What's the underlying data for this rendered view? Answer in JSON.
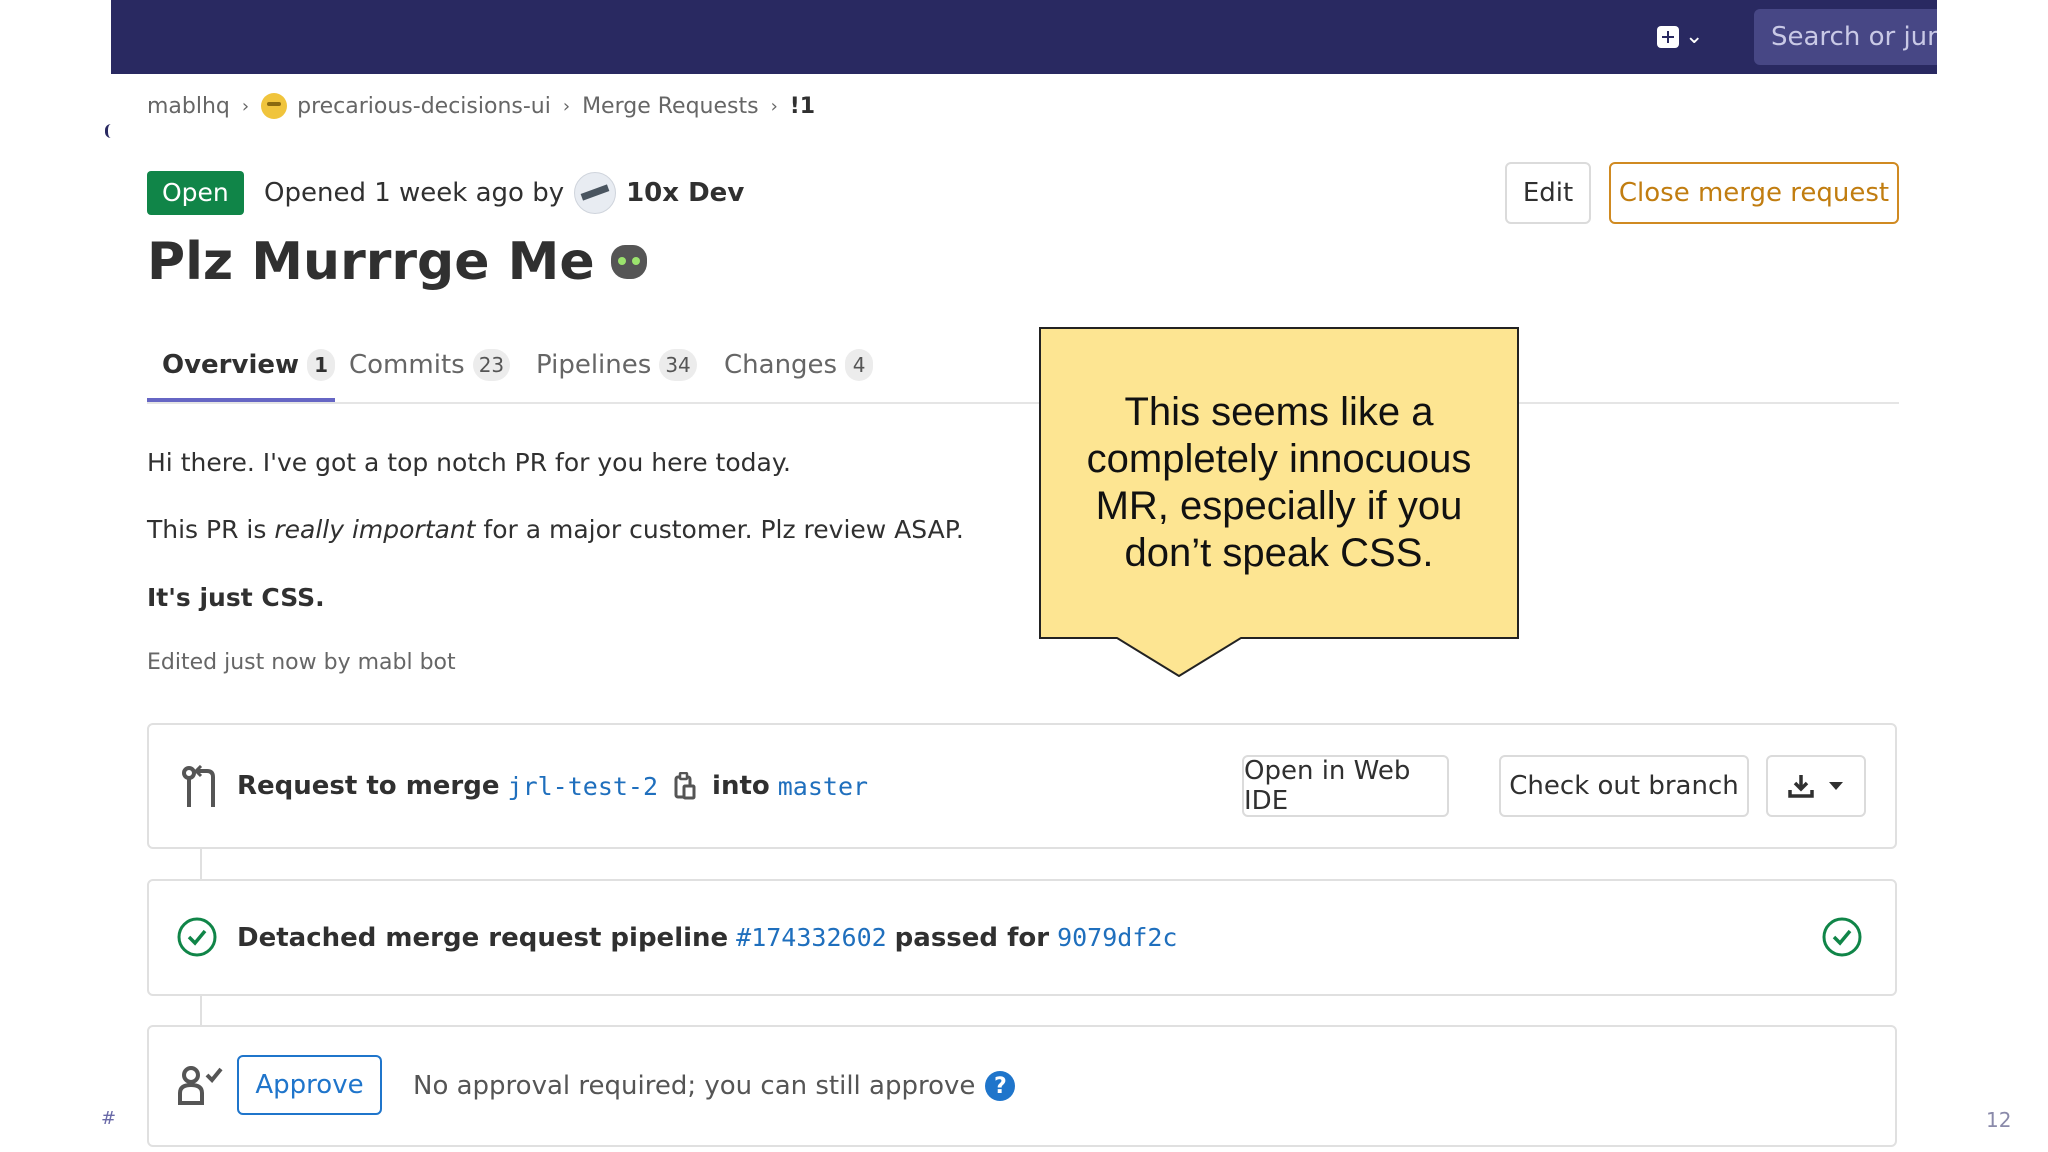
{
  "header": {
    "search_placeholder": "Search or jum"
  },
  "breadcrumb": {
    "group": "mablhq",
    "project": "precarious-decisions-ui",
    "section": "Merge Requests",
    "current": "!1"
  },
  "mr": {
    "status": "Open",
    "opened_text": "Opened 1 week ago by",
    "author": "10x Dev",
    "title": "Plz Murrrge Me",
    "edit_label": "Edit",
    "close_label": "Close merge request"
  },
  "tabs": [
    {
      "label": "Overview",
      "count": "1"
    },
    {
      "label": "Commits",
      "count": "23"
    },
    {
      "label": "Pipelines",
      "count": "34"
    },
    {
      "label": "Changes",
      "count": "4"
    }
  ],
  "description": {
    "p1": "Hi there. I've got a top notch PR for you here today.",
    "p2_before": "This PR is ",
    "p2_em": "really important",
    "p2_after": " for a major customer. Plz review ASAP.",
    "p3": "It's just CSS.",
    "edited": "Edited just now by mabl bot"
  },
  "callout": {
    "text": "This seems like a completely innocuous MR, especially if you don’t speak CSS."
  },
  "merge_widget": {
    "prefix": "Request to merge",
    "source_branch": "jrl-test-2",
    "into": "into",
    "target_branch": "master",
    "open_web_ide": "Open in Web IDE",
    "check_out_branch": "Check out branch"
  },
  "pipeline": {
    "prefix": "Detached merge request pipeline",
    "id": "#174332602",
    "middle": "passed for",
    "sha": "9079df2c",
    "status_color": "#108548"
  },
  "approval": {
    "button": "Approve",
    "text": "No approval required; you can still approve",
    "help": "?"
  },
  "slide": {
    "hash": "#",
    "number": "12"
  },
  "colors": {
    "topbar": "#292961",
    "open_badge": "#108548",
    "close_button": "#c17d10",
    "link": "#1f6fbd",
    "callout_bg": "#fde592",
    "tab_active": "#6666c4"
  }
}
